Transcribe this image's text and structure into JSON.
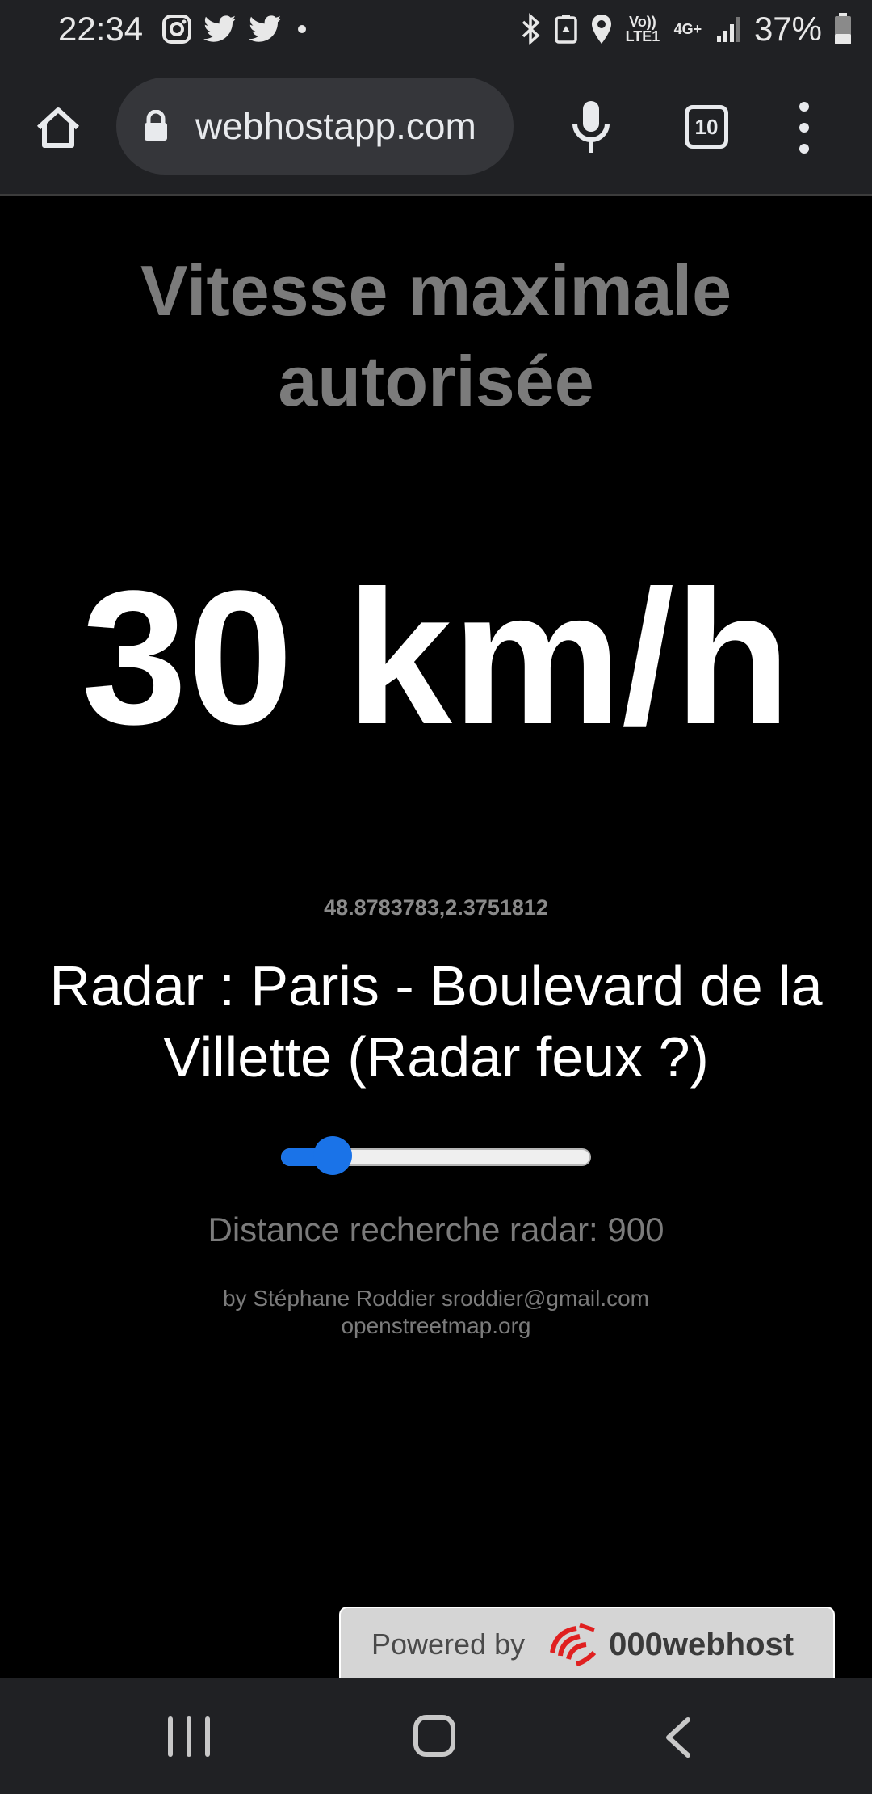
{
  "status_bar": {
    "time": "22:34",
    "left_icons": [
      "instagram-icon",
      "twitter-icon",
      "twitter-icon",
      "dot-icon"
    ],
    "right_icons": [
      "bluetooth-icon",
      "nfc-icon",
      "location-icon",
      "volte-icon",
      "network-4g-icon",
      "signal-icon",
      "battery-icon"
    ],
    "volte_label": "Vo)) LTE1",
    "network_label": "4G+",
    "battery": "37%"
  },
  "toolbar": {
    "url": "webhostapp.com",
    "tab_count": "10"
  },
  "page": {
    "heading": "Vitesse maximale autorisée",
    "speed": "30 km/h",
    "coordinates": "48.8783783,2.3751812",
    "radar_name": "Radar : Paris - Boulevard de la Villette (Radar feux ?)",
    "slider_fraction": 0.12,
    "distance_label": "Distance recherche radar: 900",
    "credits_line1": "by Stéphane Roddier sroddier@gmail.com",
    "credits_line2": "openstreetmap.org"
  },
  "powered_by": {
    "label": "Powered by",
    "brand": "000webhost"
  },
  "colors": {
    "accent": "#1a73e8",
    "heading_gray": "#7b7b7b",
    "chrome_bar": "#202124"
  }
}
